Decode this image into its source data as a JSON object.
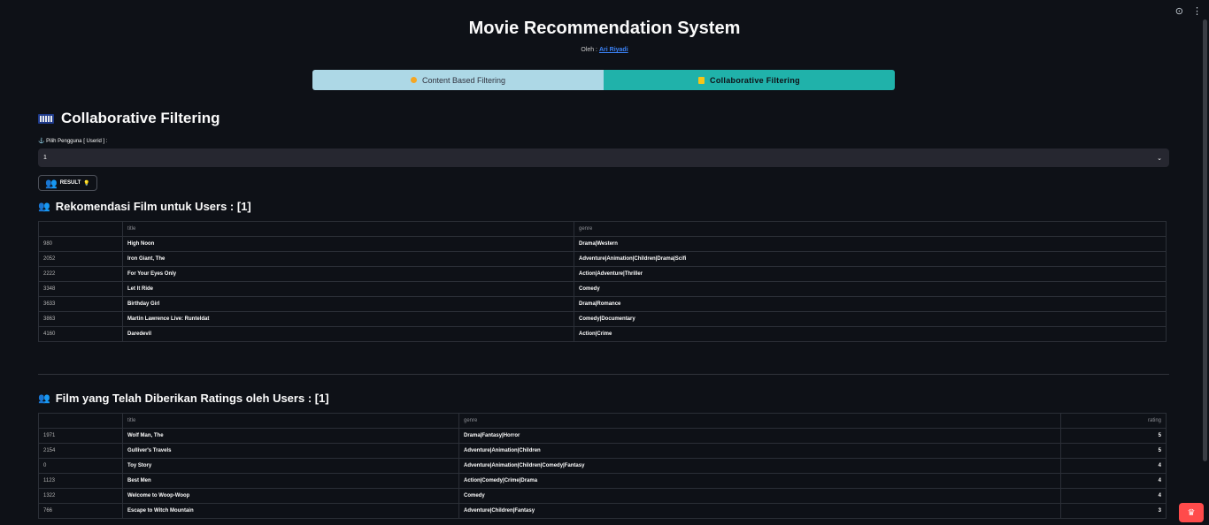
{
  "app": {
    "title": "Movie Recommendation System",
    "byline_prefix": "Oleh :",
    "author": "Ari Riyadi"
  },
  "top_icons": [
    {
      "name": "github-icon",
      "glyph": "⊙"
    },
    {
      "name": "menu-icon",
      "glyph": "⋮"
    }
  ],
  "tabs": [
    {
      "label": "Content Based Filtering",
      "active": false
    },
    {
      "label": "Collaborative Filtering",
      "active": true
    }
  ],
  "section": {
    "title": "Collaborative Filtering",
    "select_label": "Pilih Pengguna [ Userid ] :",
    "select_value": "1",
    "result_button": "RESULT"
  },
  "recommendations": {
    "title": "Rekomendasi Film untuk Users : [1]",
    "columns": [
      "",
      "title",
      "genre"
    ],
    "rows": [
      [
        "980",
        "High Noon",
        "Drama|Western"
      ],
      [
        "2052",
        "Iron Giant, The",
        "Adventure|Animation|Children|Drama|Scifi"
      ],
      [
        "2222",
        "For Your Eyes Only",
        "Action|Adventure|Thriller"
      ],
      [
        "3348",
        "Let It Ride",
        "Comedy"
      ],
      [
        "3633",
        "Birthday Girl",
        "Drama|Romance"
      ],
      [
        "3863",
        "Martin Lawrence Live: Runteldat",
        "Comedy|Documentary"
      ],
      [
        "4160",
        "Daredevil",
        "Action|Crime"
      ]
    ]
  },
  "rated": {
    "title": "Film yang Telah Diberikan Ratings oleh Users : [1]",
    "columns": [
      "",
      "title",
      "genre",
      "rating"
    ],
    "rows": [
      [
        "1971",
        "Wolf Man, The",
        "Drama|Fantasy|Horror",
        "5"
      ],
      [
        "2154",
        "Gulliver's Travels",
        "Adventure|Animation|Children",
        "5"
      ],
      [
        "0",
        "Toy Story",
        "Adventure|Animation|Children|Comedy|Fantasy",
        "4"
      ],
      [
        "1123",
        "Best Men",
        "Action|Comedy|Crime|Drama",
        "4"
      ],
      [
        "1322",
        "Welcome to Woop-Woop",
        "Comedy",
        "4"
      ],
      [
        "766",
        "Escape to Witch Mountain",
        "Adventure|Children|Fantasy",
        "3"
      ]
    ]
  },
  "colors": {
    "background": "#0e1117",
    "tab_inactive": "#add8e6",
    "tab_active": "#20b2aa",
    "badge": "#ff4b4b"
  }
}
